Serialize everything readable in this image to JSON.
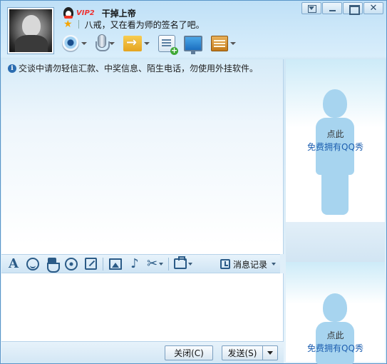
{
  "header": {
    "vip": "VIP2",
    "nickname": "干掉上帝",
    "signature": "八戒，又在看为师的签名了吧。"
  },
  "toolbar": {
    "items": [
      "webcam",
      "voice",
      "file-transfer",
      "message-add",
      "remote-desktop",
      "apps"
    ]
  },
  "notice": "交谈中请勿轻信汇款、中奖信息、陌生电话，勿使用外挂软件。",
  "format_bar": {
    "history_label": "消息记录"
  },
  "buttons": {
    "close": "关闭(C)",
    "send": "发送(S)"
  },
  "qq_show": {
    "line1": "点此",
    "line2": "免费拥有QQ秀"
  },
  "colors": {
    "accent": "#5a95c8",
    "link": "#1d5fb0",
    "silhouette": "#a7d4ef"
  }
}
